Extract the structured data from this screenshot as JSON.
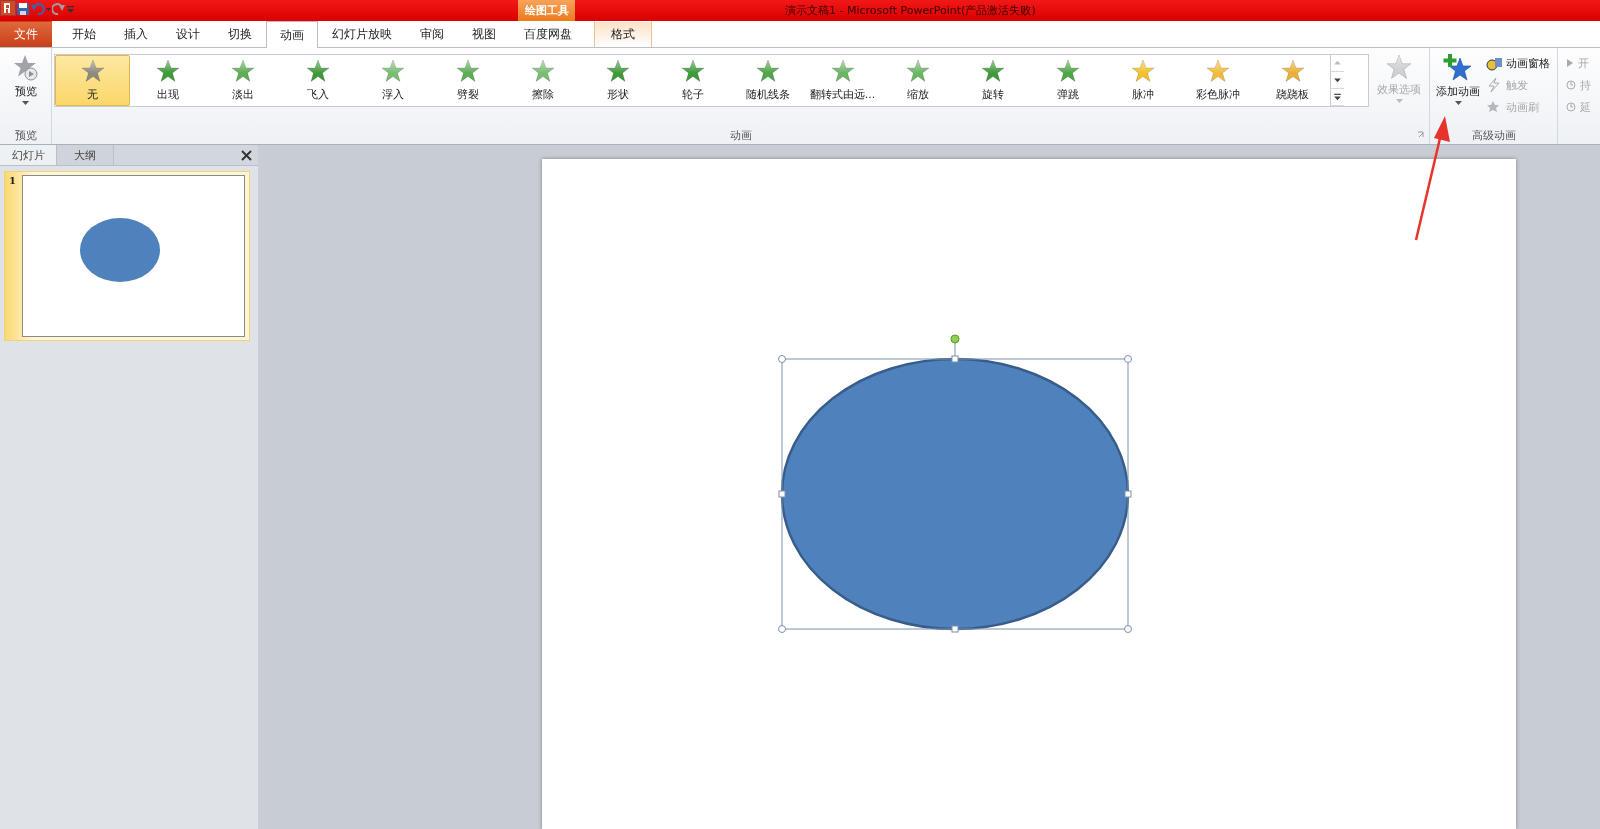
{
  "app_title": "演示文稿1 - Microsoft PowerPoint(产品激活失败)",
  "contextual_group": "绘图工具",
  "tabs": [
    {
      "label": "文件",
      "kind": "file",
      "selected": false
    },
    {
      "label": "开始",
      "kind": "normal",
      "selected": false
    },
    {
      "label": "插入",
      "kind": "normal",
      "selected": false
    },
    {
      "label": "设计",
      "kind": "normal",
      "selected": false
    },
    {
      "label": "切换",
      "kind": "normal",
      "selected": false
    },
    {
      "label": "动画",
      "kind": "normal",
      "selected": true
    },
    {
      "label": "幻灯片放映",
      "kind": "normal",
      "selected": false
    },
    {
      "label": "审阅",
      "kind": "normal",
      "selected": false
    },
    {
      "label": "视图",
      "kind": "normal",
      "selected": false
    },
    {
      "label": "百度网盘",
      "kind": "normal",
      "selected": false
    },
    {
      "label": "格式",
      "kind": "contextual",
      "selected": false
    }
  ],
  "ribbon": {
    "preview": {
      "button": "预览",
      "group_label": "预览"
    },
    "animation": {
      "group_label": "动画",
      "items": [
        {
          "label": "无",
          "color": "#8f8a80",
          "selected": true
        },
        {
          "label": "出现",
          "color": "#3f9a3a",
          "selected": false
        },
        {
          "label": "淡出",
          "color": "#5dae55",
          "selected": false
        },
        {
          "label": "飞入",
          "color": "#3f9a3a",
          "selected": false
        },
        {
          "label": "浮入",
          "color": "#7bbd73",
          "selected": false
        },
        {
          "label": "劈裂",
          "color": "#5dae55",
          "selected": false
        },
        {
          "label": "擦除",
          "color": "#7bbd73",
          "selected": false
        },
        {
          "label": "形状",
          "color": "#3f9a3a",
          "selected": false
        },
        {
          "label": "轮子",
          "color": "#3f9a3a",
          "selected": false
        },
        {
          "label": "随机线条",
          "color": "#4fa648",
          "selected": false
        },
        {
          "label": "翻转式由远...",
          "color": "#6bb563",
          "selected": false
        },
        {
          "label": "缩放",
          "color": "#6bb563",
          "selected": false
        },
        {
          "label": "旋转",
          "color": "#3f9a3a",
          "selected": false
        },
        {
          "label": "弹跳",
          "color": "#4fa648",
          "selected": false
        },
        {
          "label": "脉冲",
          "color": "#f2c12e",
          "selected": false
        },
        {
          "label": "彩色脉冲",
          "color": "#f0bd3a",
          "selected": false
        },
        {
          "label": "跷跷板",
          "color": "#e9b236",
          "selected": false
        }
      ],
      "effect_options": {
        "label": "效果选项",
        "disabled": true
      }
    },
    "advanced": {
      "group_label": "高级动画",
      "add_animation": "添加动画",
      "items": [
        {
          "label": "动画窗格",
          "disabled": false
        },
        {
          "label": "触发",
          "disabled": true
        },
        {
          "label": "动画刷",
          "disabled": true
        }
      ]
    },
    "timing": {
      "items": [
        "开",
        "持",
        "延"
      ]
    }
  },
  "slides_pane": {
    "tabs": [
      {
        "label": "幻灯片",
        "selected": true
      },
      {
        "label": "大纲",
        "selected": false
      }
    ],
    "thumbnails": [
      {
        "number": "1",
        "selected": true
      }
    ]
  },
  "slide": {
    "shape": {
      "kind": "ellipse",
      "selected": true
    }
  }
}
